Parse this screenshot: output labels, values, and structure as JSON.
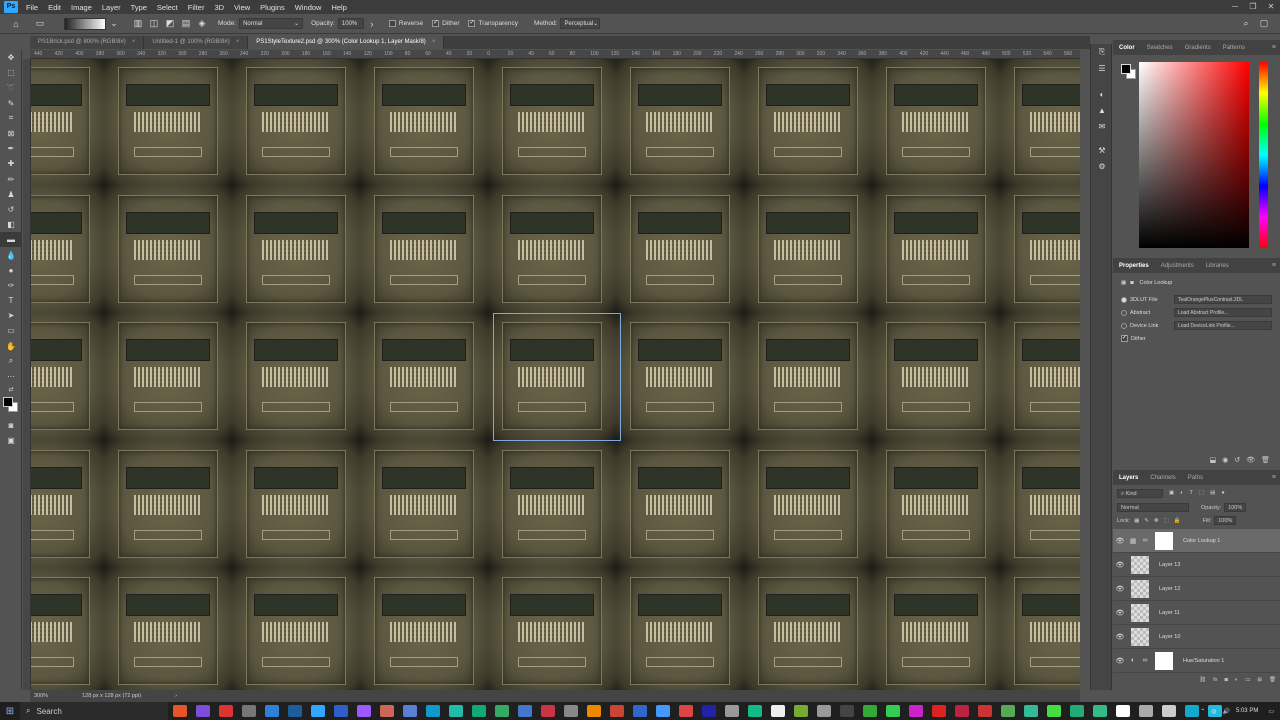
{
  "app": {
    "name": "Ps"
  },
  "menu": [
    "File",
    "Edit",
    "Image",
    "Layer",
    "Type",
    "Select",
    "Filter",
    "3D",
    "View",
    "Plugins",
    "Window",
    "Help"
  ],
  "options": {
    "mode_label": "Mode:",
    "mode_value": "Normal",
    "opacity_label": "Opacity:",
    "opacity_value": "100%",
    "reverse": "Reverse",
    "dither": "Dither",
    "transparency": "Transparency",
    "method_label": "Method:",
    "method_value": "Perceptual"
  },
  "tabs": [
    {
      "label": "PS1Brick.psd @ 800% (RGB/8#)"
    },
    {
      "label": "Untitled-1 @ 100% (RGB/8#)"
    },
    {
      "label": "PS1StyleTexture2.psd @ 300% (Color Lookup 1, Layer Mask/8)"
    }
  ],
  "ruler_ticks": [
    "440",
    "420",
    "400",
    "380",
    "360",
    "340",
    "320",
    "300",
    "280",
    "260",
    "240",
    "220",
    "200",
    "180",
    "160",
    "140",
    "120",
    "100",
    "80",
    "60",
    "40",
    "20",
    "0",
    "20",
    "40",
    "60",
    "80",
    "100",
    "120",
    "140",
    "160",
    "180",
    "200",
    "220",
    "240",
    "260",
    "280",
    "300",
    "320",
    "340",
    "360",
    "380",
    "400",
    "420",
    "440",
    "460",
    "480",
    "500",
    "520",
    "540",
    "560"
  ],
  "status": {
    "zoom": "300%",
    "size": "128 px x 128 px (72 ppi)"
  },
  "color_panel": {
    "tabs": [
      "Color",
      "Swatches",
      "Gradients",
      "Patterns"
    ]
  },
  "properties": {
    "tabs": [
      "Properties",
      "Adjustments",
      "Libraries"
    ],
    "title": "Color Lookup",
    "lut_label": "3DLUT File",
    "lut_value": "TealOrangePlusContrast.3DL",
    "abstract_label": "Abstract",
    "abstract_value": "Load Abstract Profile...",
    "devicelink_label": "Device Link",
    "devicelink_value": "Load DeviceLink Profile...",
    "dither_label": "Dither"
  },
  "layers": {
    "tabs": [
      "Layers",
      "Channels",
      "Paths"
    ],
    "kind": "Kind",
    "blend": "Normal",
    "opacity_label": "Opacity:",
    "opacity_value": "100%",
    "lock_label": "Lock:",
    "fill_label": "Fill:",
    "fill_value": "100%",
    "items": [
      {
        "name": "Color Lookup 1"
      },
      {
        "name": "Layer 13"
      },
      {
        "name": "Layer 12"
      },
      {
        "name": "Layer 11"
      },
      {
        "name": "Layer 10"
      },
      {
        "name": "Hue/Saturation 1"
      }
    ]
  },
  "taskbar": {
    "search": "Search",
    "time": "5:03 PM",
    "app_colors": [
      "#e8542a",
      "#7d4cdb",
      "#d33",
      "#777",
      "#2f7fd6",
      "#1b5e9c",
      "#31a8ff",
      "#2f5ec9",
      "#9b59ff",
      "#c65",
      "#5b7fd6",
      "#19c",
      "#2ba",
      "#1a7",
      "#3a6",
      "#47c",
      "#c34",
      "#888",
      "#e80",
      "#c43",
      "#36c",
      "#49f",
      "#d44",
      "#22a",
      "#999",
      "#1b8",
      "#eee",
      "#7a3",
      "#999",
      "#444",
      "#3a3",
      "#3c5",
      "#c2c",
      "#d22",
      "#b24",
      "#c33",
      "#5a5",
      "#3b9",
      "#4d4",
      "#2a7",
      "#3b8",
      "#fff",
      "#aaa",
      "#ccc",
      "#1ac",
      "#2bd"
    ]
  }
}
